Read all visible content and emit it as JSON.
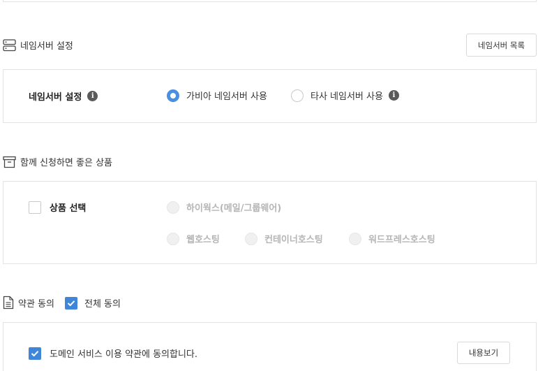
{
  "nameserver": {
    "section_title": "네임서버 설정",
    "list_button": "네임서버 목록",
    "row_label": "네임서버 설정",
    "info_glyph": "i",
    "options": [
      {
        "label": "가비아 네임서버 사용",
        "selected": true
      },
      {
        "label": "타사 네임서버 사용",
        "selected": false
      }
    ]
  },
  "products": {
    "section_title": "함께 신청하면 좋은 상품",
    "select_label": "상품 선택",
    "options": [
      {
        "label": "하이웍스(메일/그룹웨어)"
      },
      {
        "label": "웹호스팅"
      },
      {
        "label": "컨테이너호스팅"
      },
      {
        "label": "워드프레스호스팅"
      }
    ]
  },
  "terms": {
    "section_title": "약관 동의",
    "agree_all_label": "전체 동의",
    "agree_all_checked": true,
    "items": [
      {
        "label": "도메인 서비스 이용 약관에 동의합니다.",
        "checked": true,
        "view_button": "내용보기"
      }
    ]
  },
  "colors": {
    "accent": "#3f86d8",
    "border": "#e3e3e3",
    "disabled_text": "#b5b5b5"
  },
  "icons": {
    "nameserver": "server-icon",
    "products": "archive-box-icon",
    "terms": "document-icon"
  }
}
